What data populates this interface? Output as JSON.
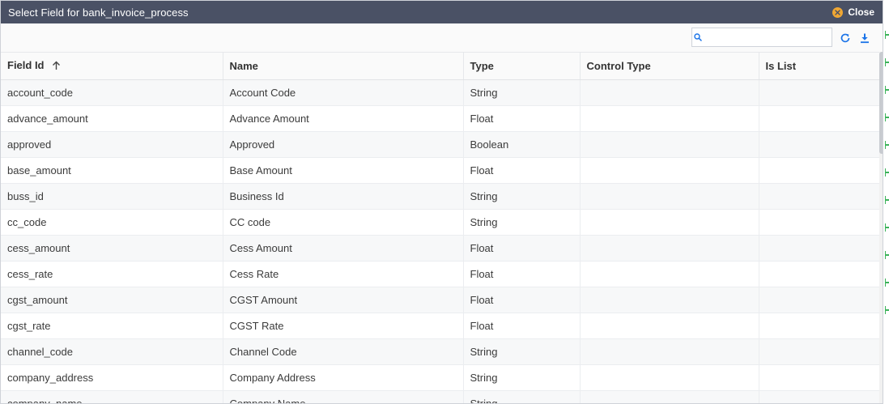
{
  "dialog": {
    "title": "Select Field for bank_invoice_process",
    "close_label": "Close"
  },
  "search": {
    "placeholder": "",
    "value": ""
  },
  "icons": {
    "refresh": "refresh-icon",
    "download": "download-icon",
    "search": "search-icon",
    "sort": "sort-ascending-icon"
  },
  "colors": {
    "titlebar": "#4a5165",
    "close_icon": "#f0a733",
    "accent": "#1a73e8",
    "edge_marks": "#3cb35a"
  },
  "table": {
    "columns": [
      "Field Id",
      "Name",
      "Type",
      "Control Type",
      "Is List"
    ],
    "sorted_column": "Field Id",
    "sort_direction": "ascending",
    "rows": [
      {
        "field_id": "account_code",
        "name": "Account Code",
        "type": "String",
        "control_type": "",
        "is_list": ""
      },
      {
        "field_id": "advance_amount",
        "name": "Advance Amount",
        "type": "Float",
        "control_type": "",
        "is_list": ""
      },
      {
        "field_id": "approved",
        "name": "Approved",
        "type": "Boolean",
        "control_type": "",
        "is_list": ""
      },
      {
        "field_id": "base_amount",
        "name": "Base Amount",
        "type": "Float",
        "control_type": "",
        "is_list": ""
      },
      {
        "field_id": "buss_id",
        "name": "Business Id",
        "type": "String",
        "control_type": "",
        "is_list": ""
      },
      {
        "field_id": "cc_code",
        "name": "CC code",
        "type": "String",
        "control_type": "",
        "is_list": ""
      },
      {
        "field_id": "cess_amount",
        "name": "Cess Amount",
        "type": "Float",
        "control_type": "",
        "is_list": ""
      },
      {
        "field_id": "cess_rate",
        "name": "Cess Rate",
        "type": "Float",
        "control_type": "",
        "is_list": ""
      },
      {
        "field_id": "cgst_amount",
        "name": "CGST Amount",
        "type": "Float",
        "control_type": "",
        "is_list": ""
      },
      {
        "field_id": "cgst_rate",
        "name": "CGST Rate",
        "type": "Float",
        "control_type": "",
        "is_list": ""
      },
      {
        "field_id": "channel_code",
        "name": "Channel Code",
        "type": "String",
        "control_type": "",
        "is_list": ""
      },
      {
        "field_id": "company_address",
        "name": "Company Address",
        "type": "String",
        "control_type": "",
        "is_list": ""
      },
      {
        "field_id": "company_name",
        "name": "Company Name",
        "type": "String",
        "control_type": "",
        "is_list": ""
      }
    ]
  }
}
